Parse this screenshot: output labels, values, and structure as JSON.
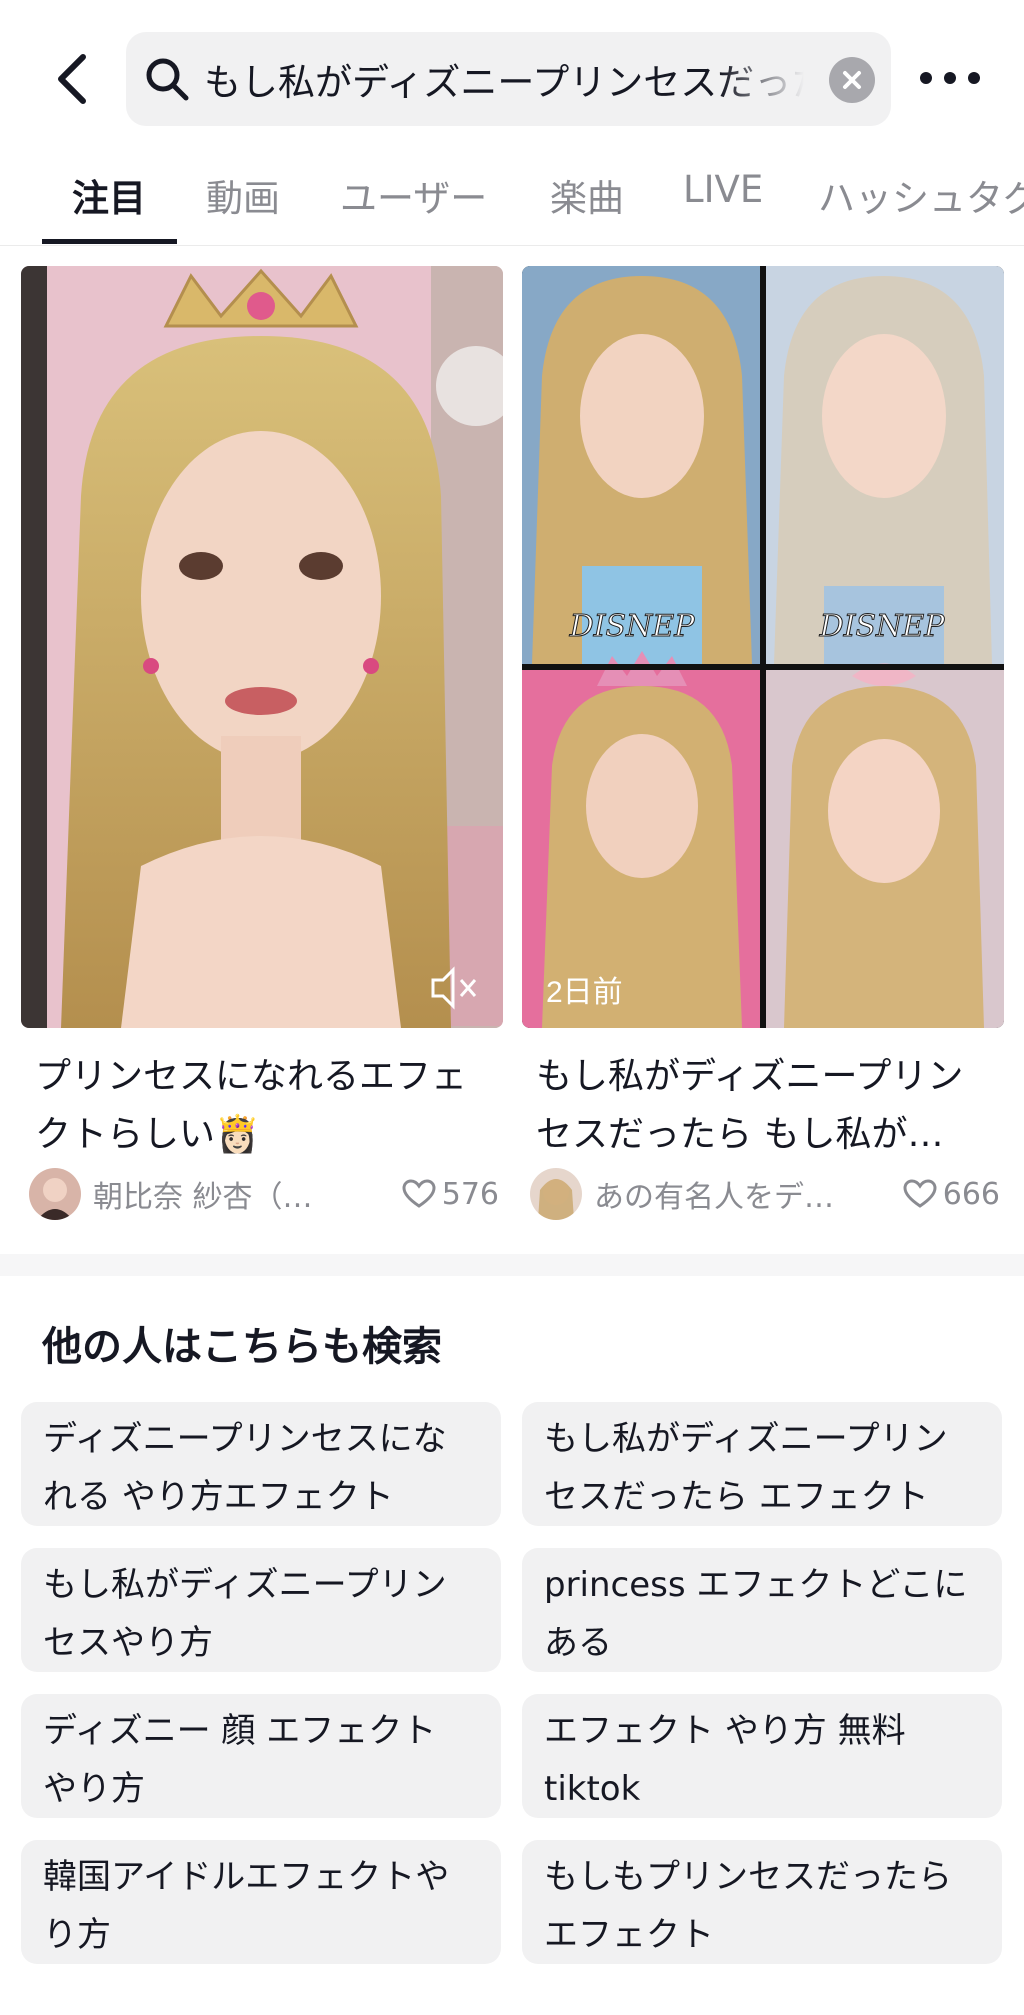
{
  "search": {
    "query": "もし私がディズニープリンセスだったら"
  },
  "tabs": [
    {
      "label": "注目"
    },
    {
      "label": "動画"
    },
    {
      "label": "ユーザー"
    },
    {
      "label": "楽曲"
    },
    {
      "label": "LIVE"
    },
    {
      "label": "ハッシュタグ"
    }
  ],
  "videos": [
    {
      "caption": "プリンセスになれるエフェクトらしい👸🏻",
      "author": "朝比奈 紗杏（…",
      "likes": "576"
    },
    {
      "caption": "もし私がディズニープリンセスだったら もし私が…",
      "author": "あの有名人をデ…",
      "likes": "666",
      "badge": "2日前",
      "watermark_text": "DISNEP"
    }
  ],
  "related": {
    "title": "他の人はこちらも検索",
    "items": [
      "ディズニープリンセスになれる やり方エフェクト",
      "もし私がディズニープリンセスだったら エフェクト",
      "もし私がディズニープリンセスやり方",
      "princess エフェクトどこにある",
      "ディズニー 顔 エフェクト やり方",
      "エフェクト やり方 無料 tiktok",
      "韓国アイドルエフェクトやり方",
      "もしもプリンセスだったら エフェクト"
    ]
  },
  "colors": {
    "text": "#161823",
    "muted": "#8a8b91",
    "pill_bg": "#f1f1f2",
    "search_bg": "#f1f1f2"
  },
  "icons": [
    "back-icon",
    "search-icon",
    "clear-icon",
    "more-icon",
    "muted-speaker-icon",
    "heart-icon"
  ]
}
